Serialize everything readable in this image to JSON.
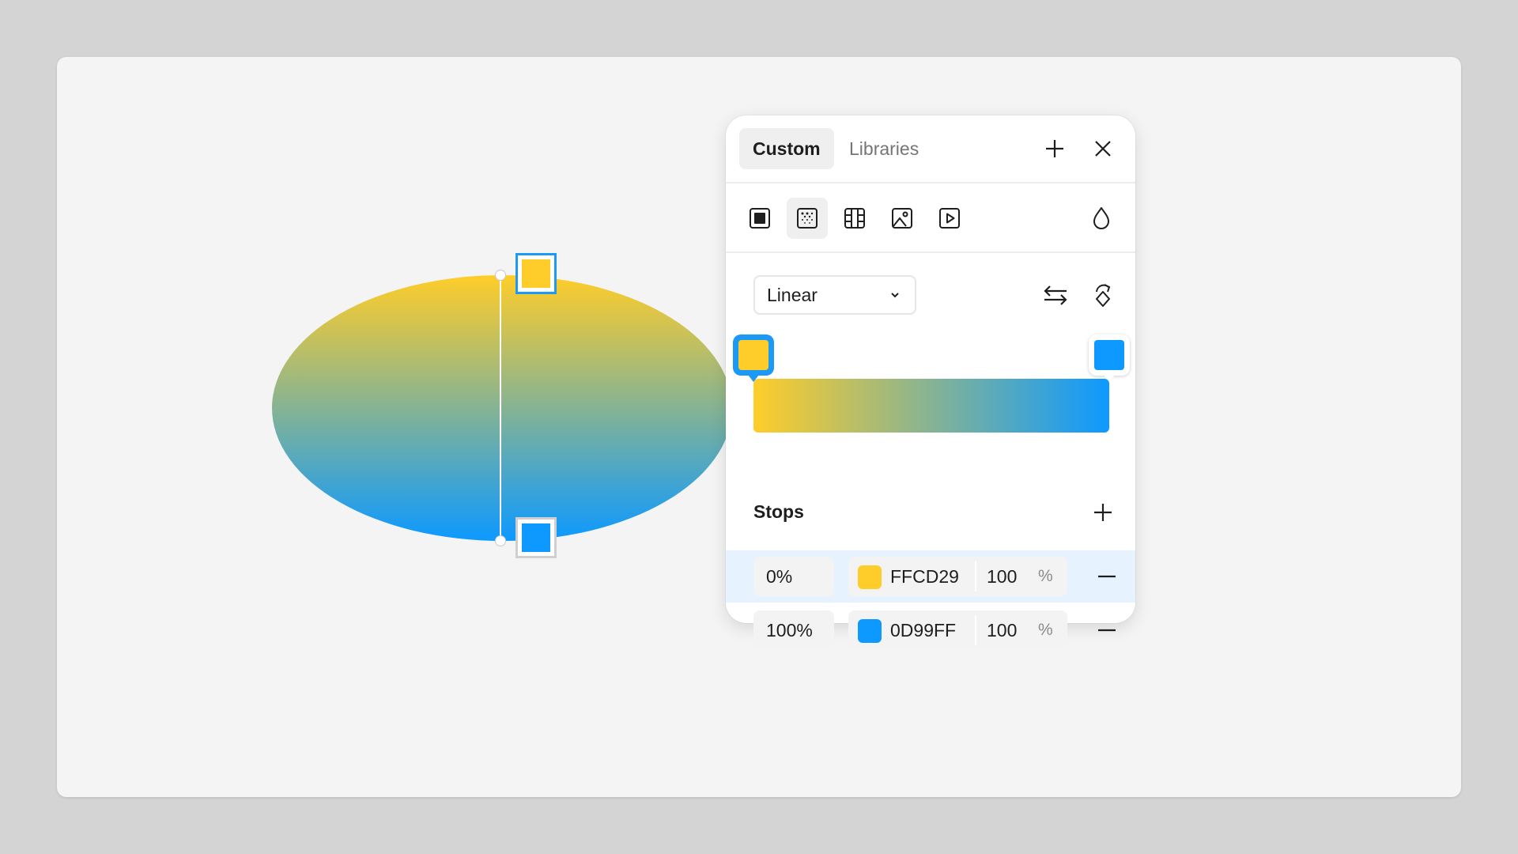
{
  "panel": {
    "tabs": [
      {
        "label": "Custom",
        "active": true
      },
      {
        "label": "Libraries",
        "active": false
      }
    ],
    "header_icons": [
      "plus-icon",
      "close-icon"
    ],
    "fill_types": [
      {
        "icon": "solid-fill-icon",
        "selected": false
      },
      {
        "icon": "gradient-fill-icon",
        "selected": true
      },
      {
        "icon": "pattern-fill-icon",
        "selected": false
      },
      {
        "icon": "image-fill-icon",
        "selected": false
      },
      {
        "icon": "video-fill-icon",
        "selected": false
      }
    ],
    "blend_icon": "drop-icon",
    "gradient_type": "Linear",
    "gradient_actions": [
      "flip-gradient-icon",
      "rotate-gradient-icon"
    ],
    "stops_title": "Stops",
    "stops": [
      {
        "position": "0%",
        "hex": "FFCD29",
        "color": "#FFCD29",
        "opacity": "100",
        "unit": "%",
        "selected": true
      },
      {
        "position": "100%",
        "hex": "0D99FF",
        "color": "#0D99FF",
        "opacity": "100",
        "unit": "%",
        "selected": false
      }
    ]
  },
  "colors": {
    "accent": "#1c98f5",
    "stop_start": "#FFCD29",
    "stop_end": "#0D99FF"
  }
}
